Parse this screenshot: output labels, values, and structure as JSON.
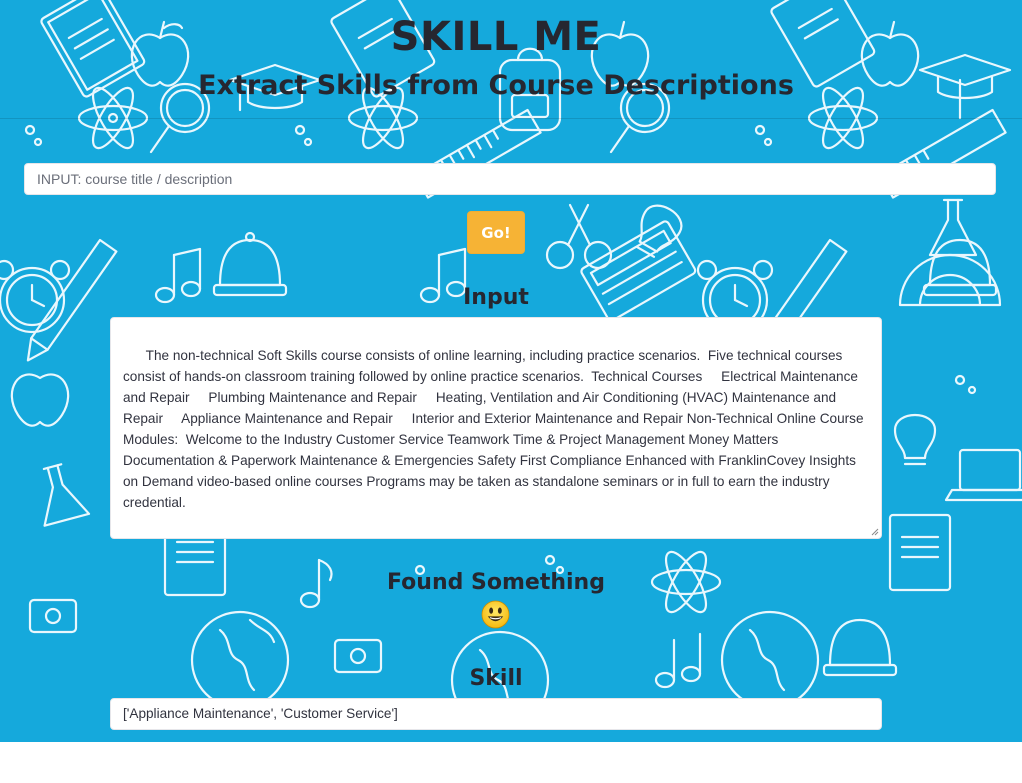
{
  "header": {
    "title": "SKILL ME",
    "subtitle": "Extract Skills from Course Descriptions"
  },
  "search": {
    "placeholder": "INPUT: course title / description",
    "value": ""
  },
  "go_button": {
    "label": "Go!"
  },
  "input_section": {
    "heading": "Input",
    "text": "The non-technical Soft Skills course consists of online learning, including practice scenarios.  Five technical courses consist of hands-on classroom training followed by online practice scenarios.  Technical Courses     Electrical Maintenance and Repair     Plumbing Maintenance and Repair     Heating, Ventilation and Air Conditioning (HVAC) Maintenance and Repair     Appliance Maintenance and Repair     Interior and Exterior Maintenance and Repair Non-Technical Online Course Modules:  Welcome to the Industry Customer Service Teamwork Time & Project Management Money Matters Documentation & Paperwork Maintenance & Emergencies Safety First Compliance Enhanced with FranklinCovey Insights on Demand video-based online courses Programs may be taken as standalone seminars or in full to earn the industry credential."
  },
  "result": {
    "status_heading": "Found Something",
    "status_icon": "smiling-face-emoji",
    "skill_heading": "Skill",
    "skills_output": "['Appliance Maintenance', 'Customer Service']"
  },
  "colors": {
    "background": "#15a9dc",
    "pattern_stroke": "#e9f7fd",
    "button": "#f6b335",
    "text": "#262730"
  }
}
